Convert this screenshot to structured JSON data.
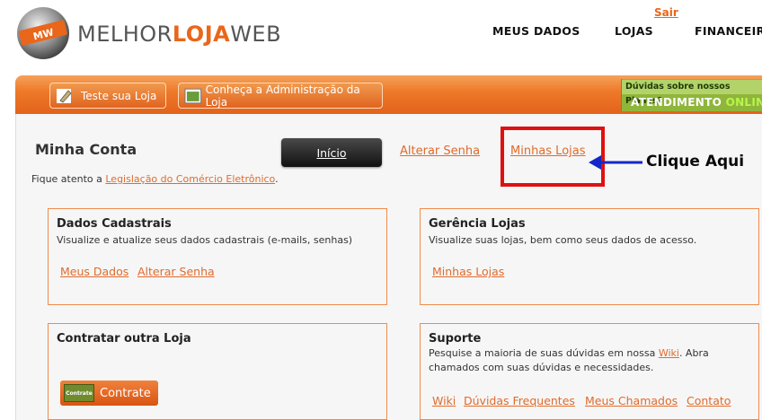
{
  "header": {
    "logo": {
      "badge": "MW",
      "text_a": "MELHOR",
      "text_b": "LOJA",
      "text_c": "WEB"
    },
    "sair": "Sair",
    "nav": [
      "MEUS DADOS",
      "LOJAS",
      "FINANCEIR"
    ]
  },
  "toolbar": {
    "teste_label": "Teste sua Loja",
    "conheca_label": "Conheça a Administração da Loja",
    "help_top": "Dúvidas sobre nossos Planos?",
    "help_bottom_a": "ATENDIMENTO",
    "help_bottom_b": "ONLINE"
  },
  "main": {
    "title": "Minha Conta",
    "inicio": "Início",
    "alterar_senha": "Alterar Senha",
    "minhas_lojas": "Minhas Lojas",
    "annotation": "Clique Aqui",
    "notice_prefix": "Fique atento a ",
    "notice_link": "Legislação do Comércio Eletrônico",
    "notice_suffix": "."
  },
  "cards": {
    "dados": {
      "title": "Dados Cadastrais",
      "desc": "Visualize e atualize seus dados cadastrais (e-mails, senhas)",
      "link1": "Meus Dados",
      "link2": "Alterar Senha"
    },
    "gerencia": {
      "title": "Gerência Lojas",
      "desc": "Visualize suas lojas, bem como seus dados de acesso.",
      "link1": "Minhas Lojas"
    },
    "contratar": {
      "title": "Contratar outra Loja",
      "button": "Contrate",
      "sign": "Contrate"
    },
    "suporte": {
      "title": "Suporte",
      "desc_a": "Pesquise a maioria de suas dúvidas em nossa ",
      "desc_link": "Wiki",
      "desc_b": ". Abra chamados com suas dúvidas e necessidades.",
      "links": [
        "Wiki",
        "Dúvidas Frequentes",
        "Meus Chamados",
        "Contato"
      ]
    }
  },
  "colors": {
    "accent": "#e9661b",
    "link": "#e06b2c",
    "highlight": "#e01010",
    "arrow": "#1428c8"
  }
}
